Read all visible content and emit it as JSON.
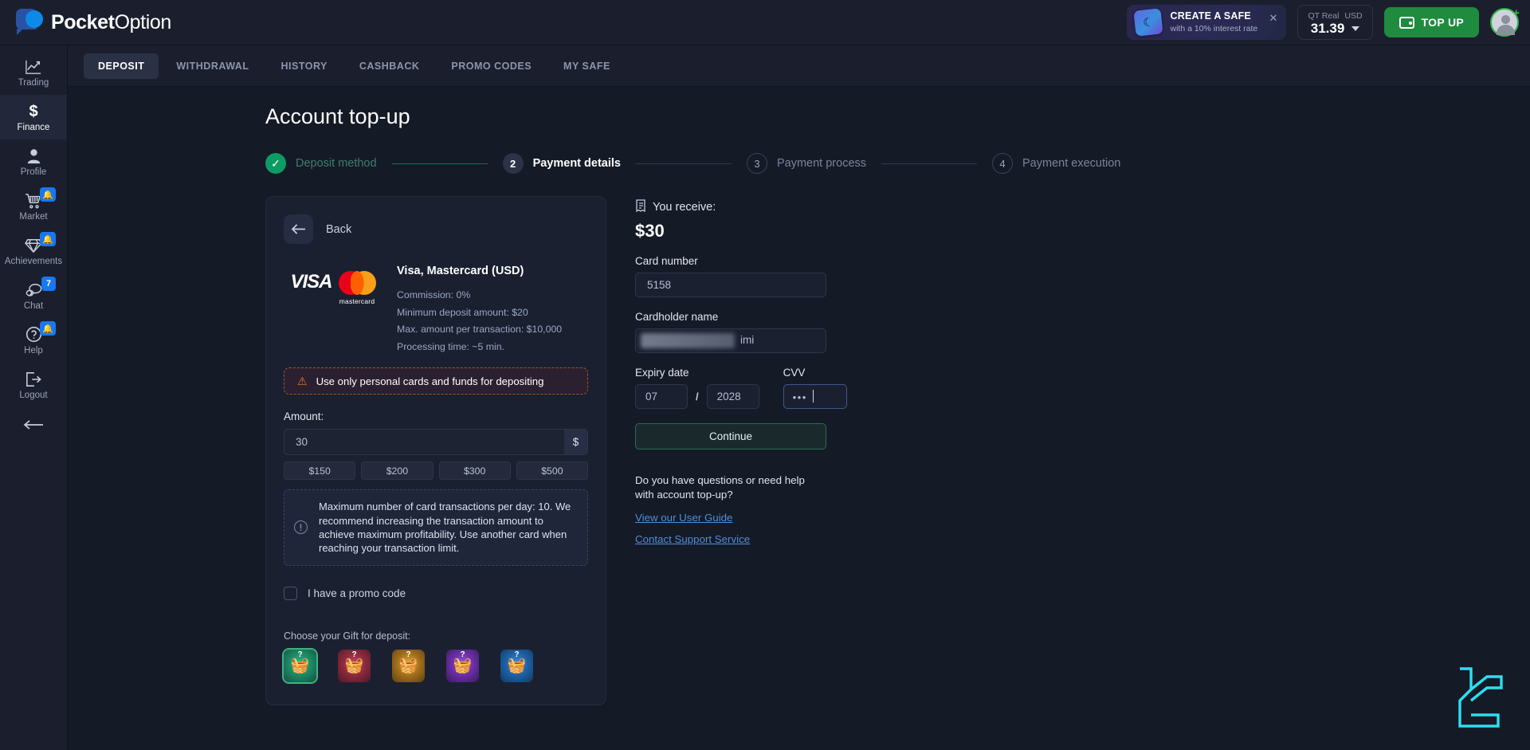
{
  "brand": {
    "name_bold": "Pocket",
    "name_light": "Option",
    "logo_icon": "pocketoption-logo-icon"
  },
  "topbar": {
    "promo": {
      "title": "CREATE A SAFE",
      "subtitle": "with a 10% interest rate",
      "icon": "safe-moon-icon",
      "close_icon": "close-icon"
    },
    "balance": {
      "account_label": "QT Real",
      "currency": "USD",
      "value": "31.39",
      "caret_icon": "chevron-down-icon"
    },
    "topup_button": {
      "label": "TOP UP",
      "icon": "wallet-icon"
    },
    "avatar": {
      "name": "user-avatar",
      "badge_icon": "plus-icon"
    }
  },
  "sidebar": {
    "items": [
      {
        "label": "Trading",
        "icon": "chart-line-icon",
        "badge": "",
        "active": false
      },
      {
        "label": "Finance",
        "icon": "dollar-icon",
        "badge": "",
        "active": true
      },
      {
        "label": "Profile",
        "icon": "user-icon",
        "badge": "",
        "active": false
      },
      {
        "label": "Market",
        "icon": "cart-icon",
        "badge": "bell",
        "active": false
      },
      {
        "label": "Achievements",
        "icon": "diamond-icon",
        "badge": "bell",
        "active": false
      },
      {
        "label": "Chat",
        "icon": "chat-icon",
        "badge": "7",
        "active": false
      },
      {
        "label": "Help",
        "icon": "question-icon",
        "badge": "bell",
        "active": false
      },
      {
        "label": "Logout",
        "icon": "logout-icon",
        "badge": "",
        "active": false
      }
    ],
    "collapse_icon": "arrow-left-icon"
  },
  "tabs": [
    {
      "label": "DEPOSIT",
      "active": true
    },
    {
      "label": "WITHDRAWAL",
      "active": false
    },
    {
      "label": "HISTORY",
      "active": false
    },
    {
      "label": "CASHBACK",
      "active": false
    },
    {
      "label": "PROMO CODES",
      "active": false
    },
    {
      "label": "MY SAFE",
      "active": false
    }
  ],
  "page": {
    "title": "Account top-up"
  },
  "stepper": [
    {
      "num": "✓",
      "label": "Deposit method",
      "state": "done"
    },
    {
      "num": "2",
      "label": "Payment details",
      "state": "current"
    },
    {
      "num": "3",
      "label": "Payment process",
      "state": "todo"
    },
    {
      "num": "4",
      "label": "Payment execution",
      "state": "todo"
    }
  ],
  "paycard": {
    "back_label": "Back",
    "back_icon": "arrow-left-icon",
    "visa_logo": "visa-logo",
    "mastercard_logo": "mastercard-logo",
    "mastercard_word": "mastercard",
    "visa_word": "VISA",
    "method_title": "Visa, Mastercard (USD)",
    "method_lines": [
      "Commission: 0%",
      "Minimum deposit amount: $20",
      "Max. amount per transaction: $10,000",
      "Processing time: ~5 min."
    ],
    "warning": {
      "text": "Use only personal cards and funds for depositing",
      "icon": "warning-triangle-icon"
    },
    "amount_label": "Amount:",
    "amount_value": "30",
    "amount_currency": "$",
    "presets": [
      "$150",
      "$200",
      "$300",
      "$500"
    ],
    "info": {
      "icon": "info-circle-icon",
      "text": "Maximum number of card transactions per day: 10. We recommend increasing the transaction amount to achieve maximum profitability. Use another card when reaching your transaction limit."
    },
    "promo_checkbox_label": "I have a promo code",
    "gift_title": "Choose your Gift for deposit:",
    "gifts": [
      {
        "color": "#1d8a66",
        "glow": "#27b383",
        "selected": true,
        "icon": "gift-chest-icon",
        "mark": "?"
      },
      {
        "color": "#8c2b3e",
        "glow": "#c4415c",
        "selected": false,
        "icon": "gift-chest-icon",
        "mark": "?"
      },
      {
        "color": "#a5711c",
        "glow": "#e0a332",
        "selected": false,
        "icon": "gift-chest-icon",
        "mark": "?"
      },
      {
        "color": "#6b2fa8",
        "glow": "#9a4fe0",
        "selected": false,
        "icon": "gift-chest-icon",
        "mark": "?"
      },
      {
        "color": "#1d62a8",
        "glow": "#2e8ddd",
        "selected": false,
        "icon": "gift-chest-icon",
        "mark": "?"
      }
    ]
  },
  "receive": {
    "icon": "receipt-icon",
    "label": "You receive:",
    "amount": "$30",
    "card_number_label": "Card number",
    "card_number_value": "5158",
    "cardholder_label": "Cardholder name",
    "cardholder_value": "imi",
    "expiry_label": "Expiry date",
    "expiry_month": "07",
    "expiry_separator": "/",
    "expiry_year": "2028",
    "cvv_label": "CVV",
    "cvv_value": "•••",
    "continue_label": "Continue",
    "help_question": "Do you have questions or need help with account top-up?",
    "help_links": [
      "View our User Guide",
      "Contact Support Service"
    ]
  },
  "watermark": {
    "name": "watermark-logo",
    "color": "#2ae0f0"
  }
}
